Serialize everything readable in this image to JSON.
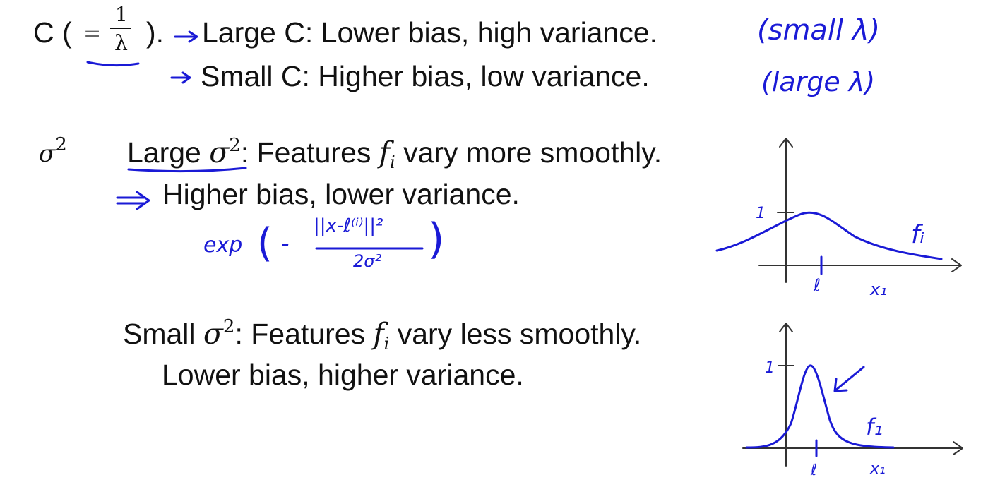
{
  "slide": {
    "c_row": {
      "c_label": "C (",
      "eq": "=",
      "numerator": "1",
      "denominator": "λ",
      "close": ").",
      "large_c": "Large C: Lower bias, high variance.",
      "small_c": "Small C: Higher bias, low variance."
    },
    "sigma_label": {
      "symbol": "σ",
      "exp": "2"
    },
    "large_sigma": {
      "prefix": "Large ",
      "symbol": "σ",
      "exp": "2",
      "mid": ": Features ",
      "f": "f",
      "f_sub": "i",
      "suffix": "  vary more smoothly.",
      "consequence": "Higher bias, lower variance."
    },
    "small_sigma": {
      "prefix": "Small ",
      "symbol": "σ",
      "exp": "2",
      "mid": ": Features ",
      "f": "f",
      "f_sub": "i",
      "suffix": " vary less smoothly.",
      "consequence": "Lower bias, higher variance."
    }
  },
  "handwriting": {
    "small_lambda": "(small  λ)",
    "large_lambda": "(large  λ)",
    "exp_word": "exp",
    "exp_open": "(",
    "exp_minus": "-",
    "exp_numer": "||x-ℓ⁽ⁱ⁾||²",
    "exp_denom": "2σ²",
    "exp_close": ")",
    "graph1": {
      "y_tick": "1",
      "l_label": "ℓ",
      "x_label": "x₁",
      "f_label": "fᵢ"
    },
    "graph2": {
      "y_tick": "1",
      "l_label": "ℓ",
      "x_label": "x₁",
      "f_label": "f₁"
    }
  },
  "colors": {
    "ink": "#1a1ad6",
    "text": "#111111",
    "axes": "#333333"
  }
}
